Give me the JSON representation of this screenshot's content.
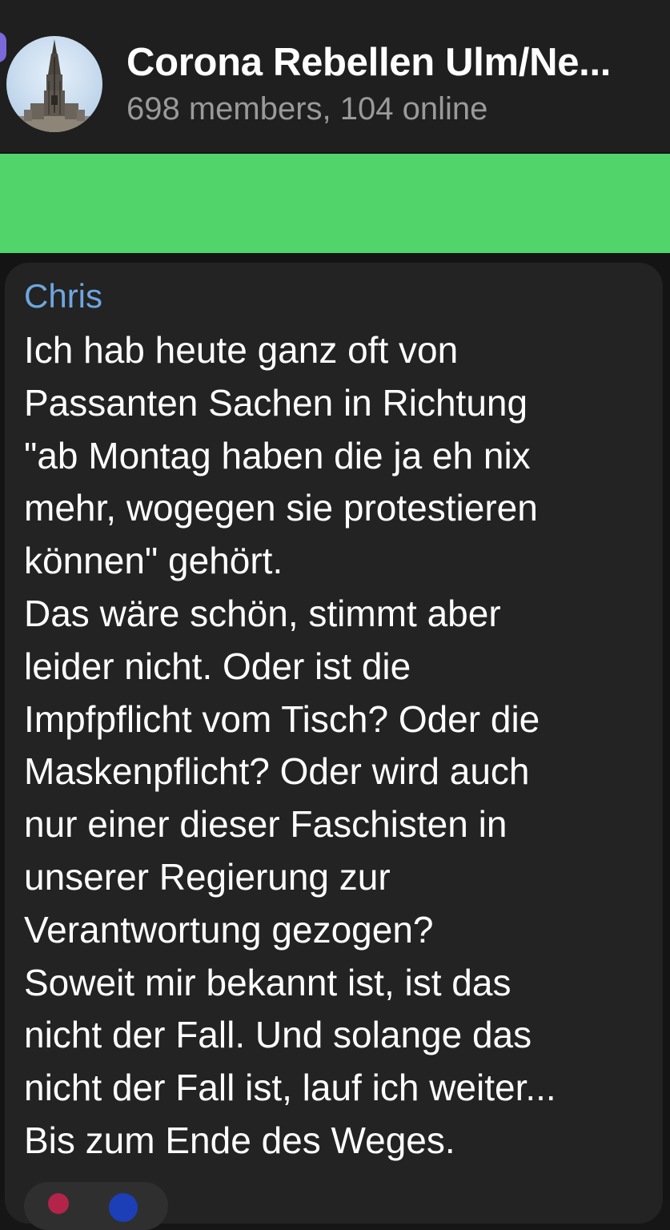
{
  "header": {
    "title": "Corona Rebellen Ulm/Ne...",
    "subtitle": "698 members, 104 online",
    "avatar_icon": "cathedral-icon"
  },
  "banner": {
    "color": "#51d46a"
  },
  "message": {
    "sender": "Chris",
    "sender_color": "#6ea6e0",
    "lines": [
      "Ich hab heute ganz oft von",
      "Passanten Sachen in Richtung",
      "\"ab Montag haben die ja eh nix",
      "mehr, wogegen sie protestieren",
      "können\" gehört.",
      "Das wäre schön, stimmt aber",
      "leider nicht. Oder ist die",
      "Impfpflicht vom Tisch? Oder die",
      "Maskenpflicht? Oder wird auch",
      "nur einer dieser Faschisten in",
      "unserer Regierung zur",
      "Verantwortung gezogen?",
      "Soweit mir bekannt ist, ist das",
      "nicht der Fall. Und solange das",
      "nicht der Fall ist, lauf ich weiter...",
      "Bis zum Ende des Weges."
    ]
  }
}
